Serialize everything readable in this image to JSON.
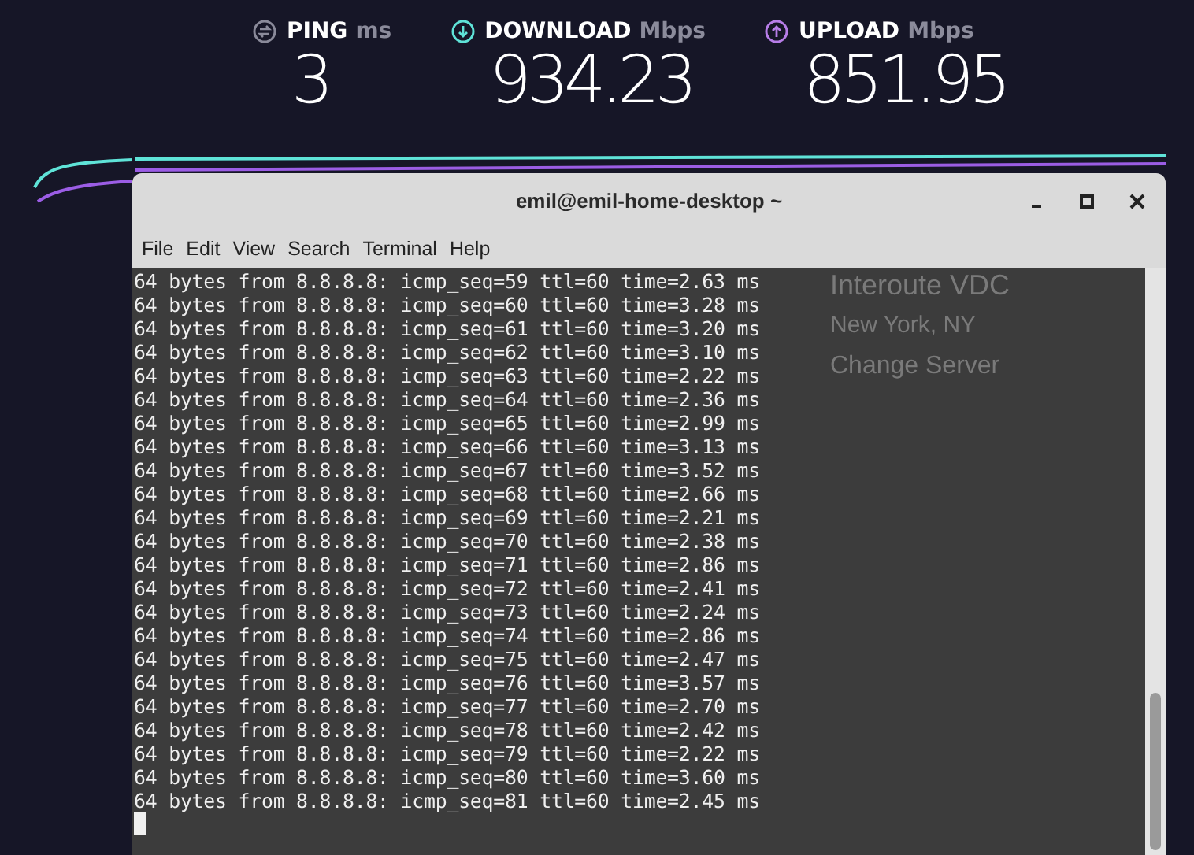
{
  "speedtest": {
    "stats": [
      {
        "kind": "ping",
        "label": "PING",
        "unit": "ms",
        "value": "3"
      },
      {
        "kind": "download",
        "label": "DOWNLOAD",
        "unit": "Mbps",
        "value": "934.23"
      },
      {
        "kind": "upload",
        "label": "UPLOAD",
        "unit": "Mbps",
        "value": "851.95"
      }
    ],
    "server": {
      "provider": "Interoute VDC",
      "location": "New York, NY",
      "change_link": "Change Server"
    }
  },
  "terminal": {
    "title": "emil@emil-home-desktop ~",
    "menu": [
      "File",
      "Edit",
      "View",
      "Search",
      "Terminal",
      "Help"
    ],
    "lines": [
      "64 bytes from 8.8.8.8: icmp_seq=59 ttl=60 time=2.63 ms",
      "64 bytes from 8.8.8.8: icmp_seq=60 ttl=60 time=3.28 ms",
      "64 bytes from 8.8.8.8: icmp_seq=61 ttl=60 time=3.20 ms",
      "64 bytes from 8.8.8.8: icmp_seq=62 ttl=60 time=3.10 ms",
      "64 bytes from 8.8.8.8: icmp_seq=63 ttl=60 time=2.22 ms",
      "64 bytes from 8.8.8.8: icmp_seq=64 ttl=60 time=2.36 ms",
      "64 bytes from 8.8.8.8: icmp_seq=65 ttl=60 time=2.99 ms",
      "64 bytes from 8.8.8.8: icmp_seq=66 ttl=60 time=3.13 ms",
      "64 bytes from 8.8.8.8: icmp_seq=67 ttl=60 time=3.52 ms",
      "64 bytes from 8.8.8.8: icmp_seq=68 ttl=60 time=2.66 ms",
      "64 bytes from 8.8.8.8: icmp_seq=69 ttl=60 time=2.21 ms",
      "64 bytes from 8.8.8.8: icmp_seq=70 ttl=60 time=2.38 ms",
      "64 bytes from 8.8.8.8: icmp_seq=71 ttl=60 time=2.86 ms",
      "64 bytes from 8.8.8.8: icmp_seq=72 ttl=60 time=2.41 ms",
      "64 bytes from 8.8.8.8: icmp_seq=73 ttl=60 time=2.24 ms",
      "64 bytes from 8.8.8.8: icmp_seq=74 ttl=60 time=2.86 ms",
      "64 bytes from 8.8.8.8: icmp_seq=75 ttl=60 time=2.47 ms",
      "64 bytes from 8.8.8.8: icmp_seq=76 ttl=60 time=3.57 ms",
      "64 bytes from 8.8.8.8: icmp_seq=77 ttl=60 time=2.70 ms",
      "64 bytes from 8.8.8.8: icmp_seq=78 ttl=60 time=2.42 ms",
      "64 bytes from 8.8.8.8: icmp_seq=79 ttl=60 time=2.22 ms",
      "64 bytes from 8.8.8.8: icmp_seq=80 ttl=60 time=3.60 ms",
      "64 bytes from 8.8.8.8: icmp_seq=81 ttl=60 time=2.45 ms"
    ]
  }
}
